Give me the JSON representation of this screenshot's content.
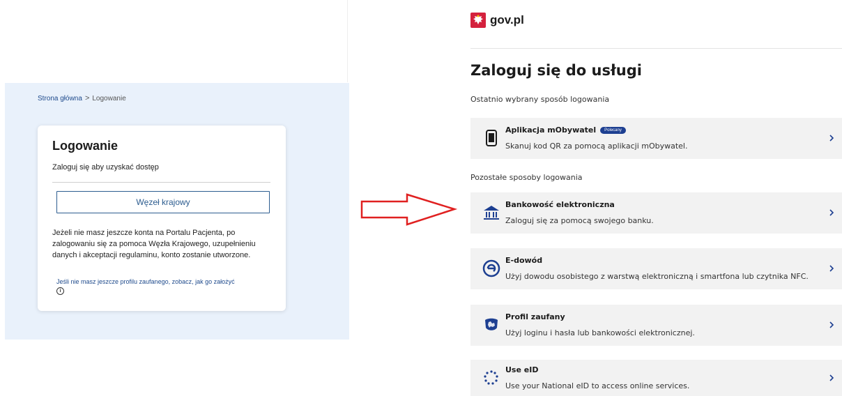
{
  "left": {
    "breadcrumb": {
      "home": "Strona główna",
      "separator": ">",
      "current": "Logowanie"
    },
    "card": {
      "title": "Logowanie",
      "subtitle": "Zaloguj się aby uzyskać dostęp",
      "button_label": "Węzeł krajowy",
      "info_text": "Jeżeli nie masz jeszcze konta na Portalu Pacjenta, po zalogowaniu się za pomoca Węzła Krajowego, uzupełnieniu danych i akceptacji regulaminu, konto zostanie utworzone.",
      "help_link": "Jeśli nie masz jeszcze profilu zaufanego, zobacz, jak go założyć",
      "info_icon": "i"
    }
  },
  "arrow": {
    "color": "#e02020",
    "icon": "right-arrow-outline"
  },
  "right": {
    "brand": "gov.pl",
    "title": "Zaloguj się do usługi",
    "recent_label": "Ostatnio wybrany sposób logowania",
    "other_label": "Pozostałe sposoby logowania",
    "recent_method": {
      "name": "Aplikacja mObywatel",
      "badge": "Polecany",
      "desc": "Skanuj kod QR za pomocą aplikacji mObywatel.",
      "icon": "phone-icon"
    },
    "methods": [
      {
        "name": "Bankowość elektroniczna",
        "desc": "Zaloguj się za pomocą swojego banku.",
        "icon": "bank-icon"
      },
      {
        "name": "E-dowód",
        "desc": "Użyj dowodu osobistego z warstwą elektroniczną i smartfona lub czytnika NFC.",
        "icon": "e-id-icon"
      },
      {
        "name": "Profil zaufany",
        "desc": "Użyj loginu i hasła lub bankowości elektronicznej.",
        "icon": "trusted-profile-icon"
      },
      {
        "name": "Use eID",
        "desc": "Use your National eID to access online services.",
        "icon": "eu-stars-icon"
      }
    ],
    "colors": {
      "accent": "#1d3f91",
      "tile": "#f2f2f2",
      "link": "#1e4a8c"
    }
  }
}
